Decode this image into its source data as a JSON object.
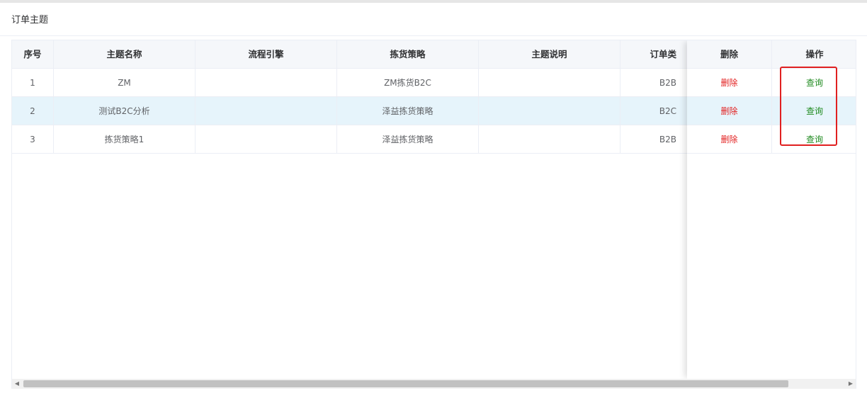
{
  "panel": {
    "title": "订单主题"
  },
  "table": {
    "headers": {
      "index": "序号",
      "name": "主题名称",
      "flow": "流程引擎",
      "strategy": "拣货策略",
      "desc": "主题说明",
      "order_type": "订单类",
      "delete": "删除",
      "action": "操作"
    },
    "rows": [
      {
        "index": "1",
        "name": "ZM",
        "flow": "",
        "strategy": "ZM拣货B2C",
        "desc": "",
        "order_type": "B2B",
        "delete": "删除",
        "action": "查询"
      },
      {
        "index": "2",
        "name": "测试B2C分析",
        "flow": "",
        "strategy": "泽益拣货策略",
        "desc": "",
        "order_type": "B2C",
        "delete": "删除",
        "action": "查询"
      },
      {
        "index": "3",
        "name": "拣货策略1",
        "flow": "",
        "strategy": "泽益拣货策略",
        "desc": "",
        "order_type": "B2B",
        "delete": "删除",
        "action": "查询"
      }
    ],
    "highlighted_row": 2
  },
  "colors": {
    "delete": "#e21f1f",
    "query": "#1f8a1f",
    "annotation": "#e02020"
  },
  "icons": {
    "scroll_left": "triangle-left-icon",
    "scroll_right": "triangle-right-icon"
  }
}
